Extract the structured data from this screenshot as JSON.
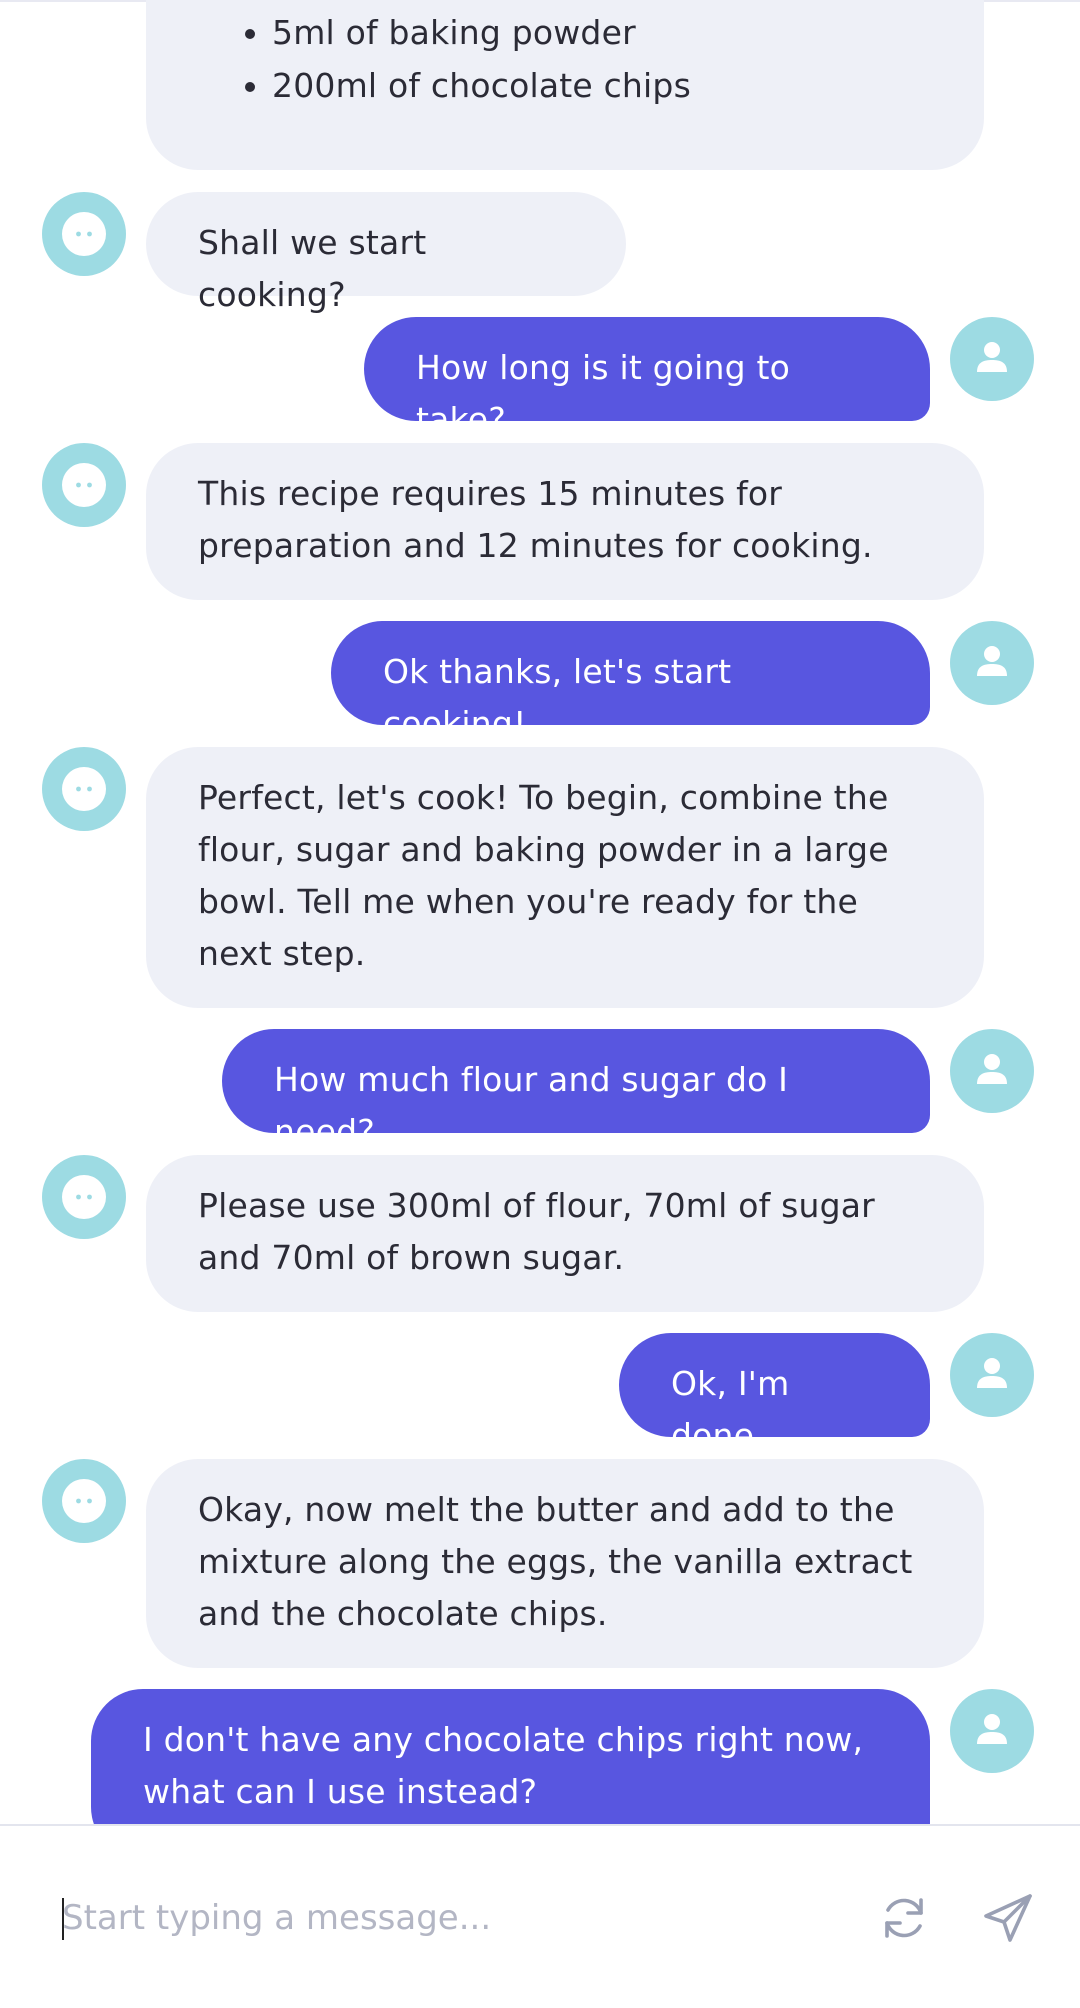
{
  "messages": [
    {
      "from": "bot",
      "type": "list",
      "items": [
        "5ml of baking powder",
        "200ml of chocolate chips"
      ]
    },
    {
      "from": "bot",
      "text": "Shall we start cooking?"
    },
    {
      "from": "user",
      "text": "How long is it going to take?"
    },
    {
      "from": "bot",
      "text": "This recipe requires 15 minutes for preparation and 12 minutes for cooking."
    },
    {
      "from": "user",
      "text": "Ok thanks, let's start cooking!"
    },
    {
      "from": "bot",
      "text": "Perfect, let's cook! To begin, combine the flour, sugar and baking powder in a large bowl. Tell me when you're ready for the next step."
    },
    {
      "from": "user",
      "text": "How much flour and sugar do I need?"
    },
    {
      "from": "bot",
      "text": "Please use 300ml of flour, 70ml of sugar and 70ml of brown sugar."
    },
    {
      "from": "user",
      "text": "Ok, I'm done"
    },
    {
      "from": "bot",
      "text": "Okay, now melt the butter and add to the mixture along the eggs, the vanilla extract and the chocolate chips."
    },
    {
      "from": "user",
      "text": "I don't have any chocolate chips right now, what can I use instead?"
    }
  ],
  "composer": {
    "placeholder": "Start typing a message...",
    "value": "",
    "refresh_icon": "refresh-icon",
    "send_icon": "send-icon"
  },
  "colors": {
    "user_bubble": "#5856e0",
    "bot_bubble": "#eef0f7",
    "avatar": "#9ddbe3",
    "placeholder": "#b3b6c4"
  }
}
